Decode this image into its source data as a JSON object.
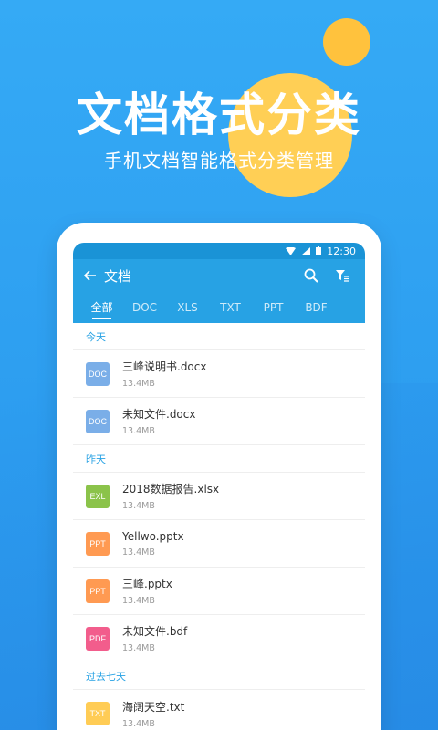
{
  "promo": {
    "headline": "文档格式分类",
    "subline": "手机文档智能格式分类管理"
  },
  "status_bar": {
    "time": "12:30"
  },
  "app_bar": {
    "back_icon": "arrow-left-icon",
    "title": "文档",
    "search_icon": "search-icon",
    "filter_icon": "filter-icon"
  },
  "tabs": [
    "全部",
    "DOC",
    "XLS",
    "TXT",
    "PPT",
    "BDF"
  ],
  "active_tab": "全部",
  "sections": [
    {
      "label": "今天",
      "files": [
        {
          "badge": "DOC",
          "name": "三峰说明书.docx",
          "size": "13.4MB",
          "color": "#7aaee8"
        },
        {
          "badge": "DOC",
          "name": "未知文件.docx",
          "size": "13.4MB",
          "color": "#7aaee8"
        }
      ]
    },
    {
      "label": "昨天",
      "files": [
        {
          "badge": "EXL",
          "name": "2018数据报告.xlsx",
          "size": "13.4MB",
          "color": "#8bc34a"
        },
        {
          "badge": "PPT",
          "name": "Yellwo.pptx",
          "size": "13.4MB",
          "color": "#ff9a52"
        },
        {
          "badge": "PPT",
          "name": "三峰.pptx",
          "size": "13.4MB",
          "color": "#ff9a52"
        },
        {
          "badge": "PDF",
          "name": "未知文件.bdf",
          "size": "13.4MB",
          "color": "#f25d8c"
        }
      ]
    },
    {
      "label": "过去七天",
      "files": [
        {
          "badge": "TXT",
          "name": "海阔天空.txt",
          "size": "13.4MB",
          "color": "#ffcc55"
        }
      ]
    }
  ],
  "colors": {
    "accent": "#27a2e4",
    "background": "#35aaf5",
    "sun": "#ffcf55"
  }
}
